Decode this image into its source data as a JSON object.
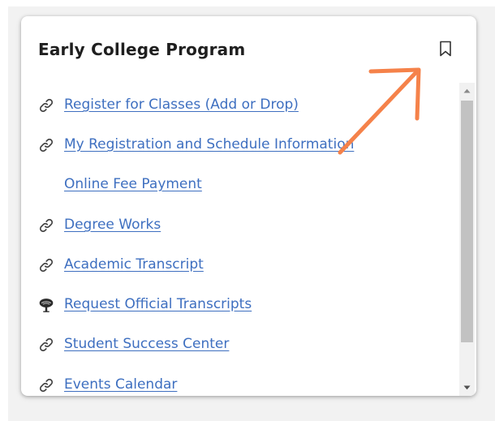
{
  "card": {
    "title": "Early College Program",
    "bookmark_icon": "bookmark-icon"
  },
  "links": [
    {
      "label": "Register for Classes (Add or Drop)",
      "icon": "link-icon"
    },
    {
      "label": "My Registration and Schedule Information",
      "icon": "link-icon"
    },
    {
      "label": "Online Fee Payment",
      "icon": ""
    },
    {
      "label": "Degree Works",
      "icon": "link-icon"
    },
    {
      "label": "Academic Transcript",
      "icon": "link-icon"
    },
    {
      "label": "Request Official Transcripts",
      "icon": "tree-logo-icon"
    },
    {
      "label": "Student Success Center",
      "icon": "link-icon"
    },
    {
      "label": "Events Calendar",
      "icon": "link-icon"
    }
  ],
  "colors": {
    "link": "#3e6fc0",
    "annotation_arrow": "#f5824a",
    "title": "#1f1f1f"
  }
}
